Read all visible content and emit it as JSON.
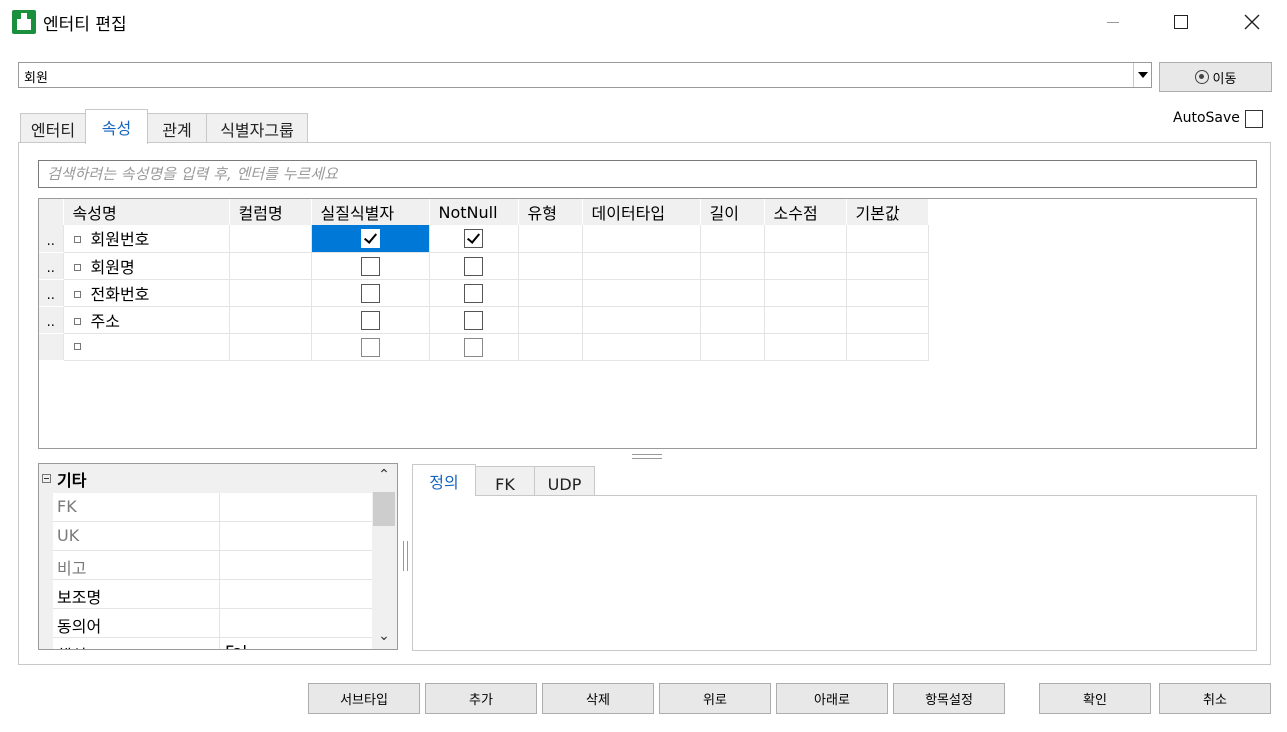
{
  "window": {
    "title": "엔터티 편집",
    "controls": [
      "minimize",
      "maximize",
      "close"
    ]
  },
  "entity_select": {
    "value": "회원"
  },
  "goto_button": {
    "label": "이동",
    "icon": "target-icon"
  },
  "autosave": {
    "label": "AutoSave",
    "checked": false
  },
  "tabs": [
    {
      "label": "엔터티",
      "active": false
    },
    {
      "label": "속성",
      "active": true
    },
    {
      "label": "관계",
      "active": false
    },
    {
      "label": "식별자그룹",
      "active": false
    }
  ],
  "search": {
    "placeholder": "검색하려는 속성명을 입력 후, 엔터를 누르세요",
    "value": ""
  },
  "grid": {
    "columns": [
      "속성명",
      "컬럼명",
      "실질식별자",
      "NotNull",
      "유형",
      "데이터타입",
      "길이",
      "소수점",
      "기본값"
    ],
    "rows": [
      {
        "marker": "..",
        "name": "회원번호",
        "column": "",
        "identifier": true,
        "notnull": true,
        "type": "",
        "datatype": "",
        "length": "",
        "scale": "",
        "default": "",
        "selected": true
      },
      {
        "marker": "..",
        "name": "회원명",
        "column": "",
        "identifier": false,
        "notnull": false,
        "type": "",
        "datatype": "",
        "length": "",
        "scale": "",
        "default": ""
      },
      {
        "marker": "..",
        "name": "전화번호",
        "column": "",
        "identifier": false,
        "notnull": false,
        "type": "",
        "datatype": "",
        "length": "",
        "scale": "",
        "default": ""
      },
      {
        "marker": "..",
        "name": "주소",
        "column": "",
        "identifier": false,
        "notnull": false,
        "type": "",
        "datatype": "",
        "length": "",
        "scale": "",
        "default": ""
      },
      {
        "marker": "",
        "name": "",
        "column": "",
        "identifier": false,
        "notnull": false,
        "type": "",
        "datatype": "",
        "length": "",
        "scale": "",
        "default": ""
      }
    ]
  },
  "property_grid": {
    "category": "기타",
    "rows": [
      {
        "key": "FK",
        "value": "",
        "dim": true
      },
      {
        "key": "UK",
        "value": "",
        "dim": true
      },
      {
        "key": "비고",
        "value": "",
        "dim": true
      },
      {
        "key": "보조명",
        "value": "",
        "dim": false
      },
      {
        "key": "동의어",
        "value": "",
        "dim": false
      },
      {
        "key": "핵심",
        "value": "Fal",
        "dim": false
      }
    ]
  },
  "lower_tabs": [
    {
      "label": "정의",
      "active": true
    },
    {
      "label": "FK",
      "active": false
    },
    {
      "label": "UDP",
      "active": false
    }
  ],
  "definition_text": "",
  "buttons": {
    "subtype": "서브타입",
    "add": "추가",
    "delete": "삭제",
    "up": "위로",
    "down": "아래로",
    "item_settings": "항목설정",
    "ok": "확인",
    "cancel": "취소"
  }
}
